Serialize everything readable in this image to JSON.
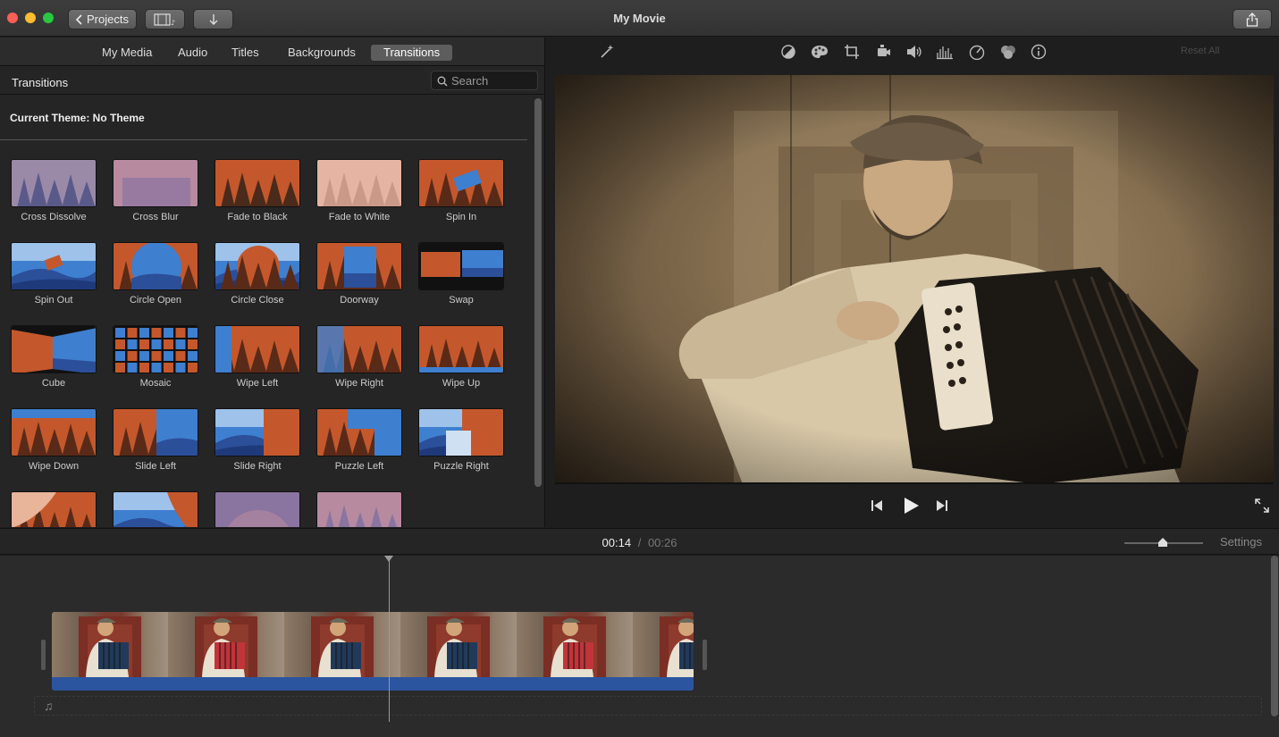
{
  "titlebar": {
    "projects_label": "Projects",
    "window_title": "My Movie"
  },
  "browser": {
    "tabs": [
      {
        "label": "My Media"
      },
      {
        "label": "Audio"
      },
      {
        "label": "Titles"
      },
      {
        "label": "Backgrounds"
      },
      {
        "label": "Transitions",
        "active": true
      }
    ],
    "title": "Transitions",
    "search_placeholder": "Search",
    "theme_label": "Current Theme: No Theme",
    "transitions": [
      {
        "label": "Cross Dissolve",
        "icon": "cross-dissolve"
      },
      {
        "label": "Cross Blur",
        "icon": "cross-blur"
      },
      {
        "label": "Fade to Black",
        "icon": "fade-to-black"
      },
      {
        "label": "Fade to White",
        "icon": "fade-to-white"
      },
      {
        "label": "Spin In",
        "icon": "spin-in"
      },
      {
        "label": "Spin Out",
        "icon": "spin-out"
      },
      {
        "label": "Circle Open",
        "icon": "circle-open"
      },
      {
        "label": "Circle Close",
        "icon": "circle-close"
      },
      {
        "label": "Doorway",
        "icon": "doorway"
      },
      {
        "label": "Swap",
        "icon": "swap"
      },
      {
        "label": "Cube",
        "icon": "cube"
      },
      {
        "label": "Mosaic",
        "icon": "mosaic"
      },
      {
        "label": "Wipe Left",
        "icon": "wipe-left"
      },
      {
        "label": "Wipe Right",
        "icon": "wipe-right"
      },
      {
        "label": "Wipe Up",
        "icon": "wipe-up"
      },
      {
        "label": "Wipe Down",
        "icon": "wipe-down"
      },
      {
        "label": "Slide Left",
        "icon": "slide-left"
      },
      {
        "label": "Slide Right",
        "icon": "slide-right"
      },
      {
        "label": "Puzzle Left",
        "icon": "puzzle-left"
      },
      {
        "label": "Puzzle Right",
        "icon": "puzzle-right"
      },
      {
        "label": "",
        "icon": "page-curl-left"
      },
      {
        "label": "",
        "icon": "page-curl-right"
      },
      {
        "label": "",
        "icon": "ripple"
      },
      {
        "label": "",
        "icon": "dissolve-soft"
      }
    ]
  },
  "viewer": {
    "reset_all_label": "Reset All",
    "tools": [
      {
        "icon": "magic-wand-icon"
      },
      {
        "icon": "color-balance-icon"
      },
      {
        "icon": "color-correction-icon"
      },
      {
        "icon": "crop-icon"
      },
      {
        "icon": "stabilization-icon"
      },
      {
        "icon": "volume-icon"
      },
      {
        "icon": "noise-reduction-icon"
      },
      {
        "icon": "speed-icon"
      },
      {
        "icon": "clip-filter-icon"
      },
      {
        "icon": "info-icon"
      }
    ]
  },
  "timeline": {
    "current_time": "00:14",
    "separator": "/",
    "total_time": "00:26",
    "settings_label": "Settings",
    "zoom_level": 0.45
  },
  "colors": {
    "accent": "#2c55a0",
    "sunset": "#c4582c",
    "sky_blue": "#3f7fcf"
  }
}
